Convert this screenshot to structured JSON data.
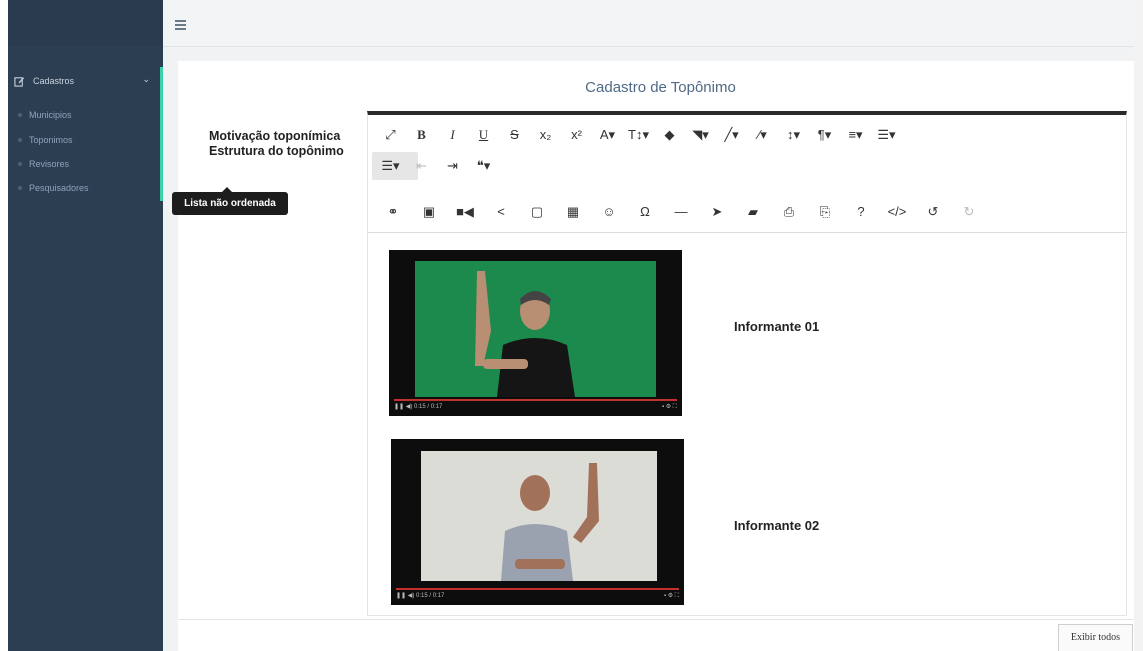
{
  "sidebar": {
    "section": {
      "label": "Cadastros",
      "icon": "edit-icon",
      "chevron": "chevron-down-icon"
    },
    "items": [
      {
        "label": "Municipios"
      },
      {
        "label": "Toponimos"
      },
      {
        "label": "Revisores"
      },
      {
        "label": "Pesquisadores"
      }
    ],
    "accent_color": "#3ad0a8",
    "background_color": "#2c3e52"
  },
  "header": {
    "menu_icon": "hamburger-icon"
  },
  "card": {
    "title": "Cadastro de Topônimo",
    "field_label_line1": "Motivação toponímica",
    "field_label_line2": "Estrutura do topônimo"
  },
  "toolbar": {
    "tooltip": "Lista não ordenada",
    "row1": [
      {
        "name": "fullscreen-icon",
        "glyph": "⤢"
      },
      {
        "name": "bold-icon",
        "glyph": "B"
      },
      {
        "name": "italic-icon",
        "glyph": "I"
      },
      {
        "name": "underline-icon",
        "glyph": "U"
      },
      {
        "name": "strikethrough-icon",
        "glyph": "S"
      },
      {
        "name": "subscript-icon",
        "glyph": "x₂"
      },
      {
        "name": "superscript-icon",
        "glyph": "x²"
      },
      {
        "name": "font-family-icon",
        "glyph": "A▾"
      },
      {
        "name": "font-size-icon",
        "glyph": "T↕▾"
      },
      {
        "name": "text-color-icon",
        "glyph": "◆"
      },
      {
        "name": "background-color-icon",
        "glyph": "◥▾"
      },
      {
        "name": "brush-icon",
        "glyph": "╱▾"
      },
      {
        "name": "magic-icon",
        "glyph": "⁄▾"
      },
      {
        "name": "line-height-icon",
        "glyph": "↕▾"
      },
      {
        "name": "paragraph-icon",
        "glyph": "¶▾"
      },
      {
        "name": "align-icon",
        "glyph": "≡▾"
      },
      {
        "name": "ordered-list-icon",
        "glyph": "☰▾"
      }
    ],
    "row2": [
      {
        "name": "unordered-list-icon",
        "glyph": "☰▾"
      },
      {
        "name": "outdent-icon",
        "glyph": "⇤"
      },
      {
        "name": "indent-icon",
        "glyph": "⇥"
      },
      {
        "name": "quote-icon",
        "glyph": "❝▾"
      }
    ],
    "row3": [
      {
        "name": "link-icon",
        "glyph": "⚭"
      },
      {
        "name": "image-icon",
        "glyph": "▣"
      },
      {
        "name": "video-icon",
        "glyph": "■◀"
      },
      {
        "name": "share-icon",
        "glyph": "<"
      },
      {
        "name": "file-icon",
        "glyph": "▢"
      },
      {
        "name": "table-icon",
        "glyph": "▦"
      },
      {
        "name": "emoji-icon",
        "glyph": "☺"
      },
      {
        "name": "special-char-icon",
        "glyph": "Ω"
      },
      {
        "name": "horizontal-line-icon",
        "glyph": "—"
      },
      {
        "name": "pointer-icon",
        "glyph": "➤"
      },
      {
        "name": "eraser-icon",
        "glyph": "▰"
      },
      {
        "name": "print-icon",
        "glyph": "⎙"
      },
      {
        "name": "pdf-icon",
        "glyph": "⎘"
      },
      {
        "name": "help-icon",
        "glyph": "?"
      },
      {
        "name": "code-view-icon",
        "glyph": "</>"
      },
      {
        "name": "undo-icon",
        "glyph": "↺"
      },
      {
        "name": "redo-icon",
        "glyph": "↻"
      }
    ]
  },
  "content": {
    "videos": [
      {
        "label": "Informante 01",
        "background": "#1c8a4c",
        "time": "0:15 / 0:17"
      },
      {
        "label": "Informante 02",
        "background": "#dcdcd6",
        "time": "0:15 / 0:17"
      }
    ]
  },
  "footer": {
    "show_all_label": "Exibir todos"
  }
}
